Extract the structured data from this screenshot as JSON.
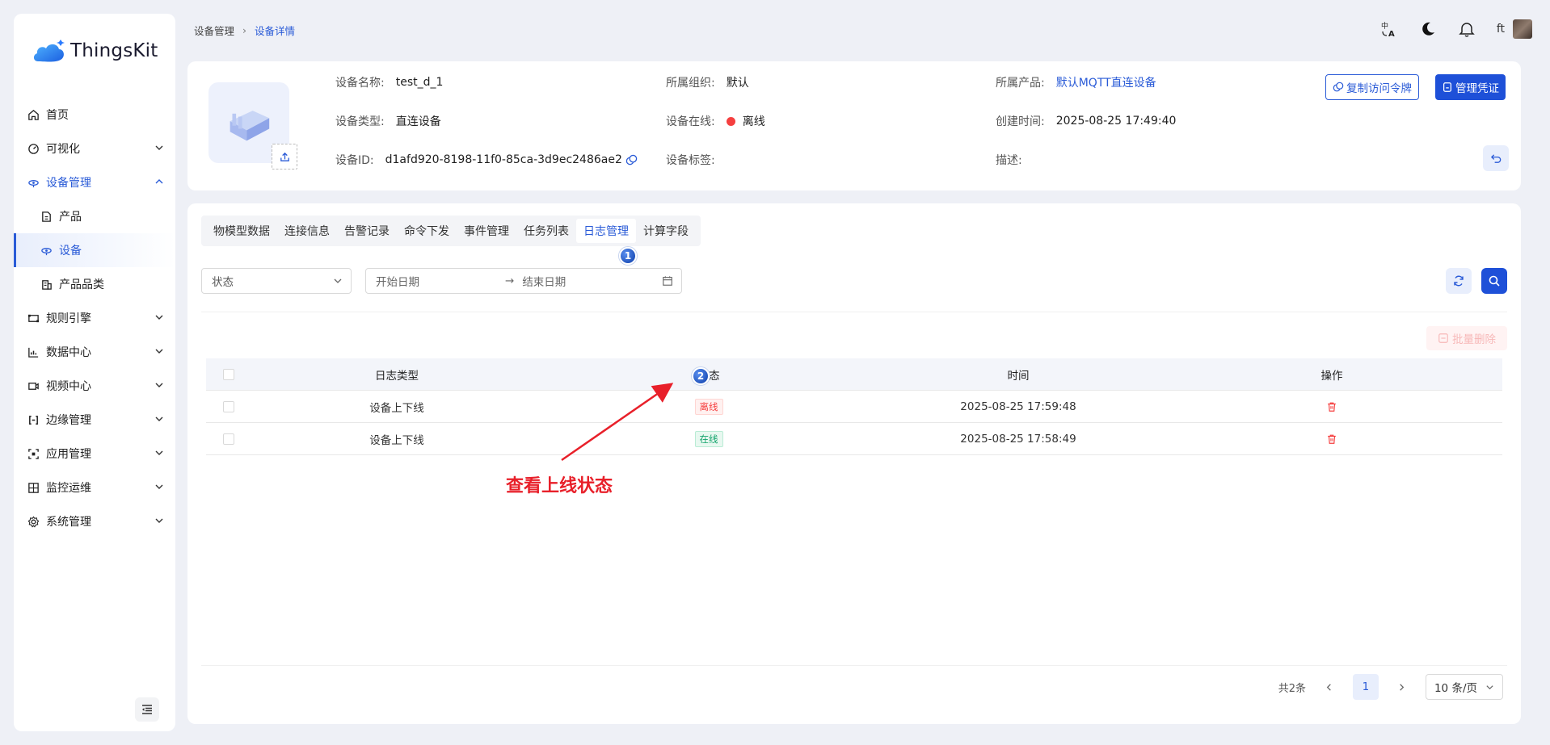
{
  "app": {
    "name": "ThingsKit"
  },
  "sidebar": {
    "items": [
      {
        "label": "首页",
        "icon": "home-icon"
      },
      {
        "label": "可视化",
        "icon": "dashboard-icon"
      },
      {
        "label": "设备管理",
        "icon": "device-icon"
      },
      {
        "label": "产品",
        "icon": "file-icon"
      },
      {
        "label": "设备",
        "icon": "device-icon"
      },
      {
        "label": "产品品类",
        "icon": "building-icon"
      },
      {
        "label": "规则引擎",
        "icon": "rule-icon"
      },
      {
        "label": "数据中心",
        "icon": "chart-icon"
      },
      {
        "label": "视频中心",
        "icon": "video-icon"
      },
      {
        "label": "边缘管理",
        "icon": "edge-icon"
      },
      {
        "label": "应用管理",
        "icon": "app-icon"
      },
      {
        "label": "监控运维",
        "icon": "monitor-icon"
      },
      {
        "label": "系统管理",
        "icon": "gear-icon"
      }
    ]
  },
  "breadcrumb": {
    "parent": "设备管理",
    "current": "设备详情"
  },
  "header": {
    "user": "ft"
  },
  "device": {
    "name_label": "设备名称:",
    "name": "test_d_1",
    "org_label": "所属组织:",
    "org": "默认",
    "product_label": "所属产品:",
    "product": "默认MQTT直连设备",
    "type_label": "设备类型:",
    "type": "直连设备",
    "online_label": "设备在线:",
    "online": "离线",
    "created_label": "创建时间:",
    "created": "2025-08-25 17:49:40",
    "id_label": "设备ID:",
    "id": "d1afd920-8198-11f0-85ca-3d9ec2486ae2",
    "tags_label": "设备标签:",
    "desc_label": "描述:",
    "copy_token_label": "复制访问令牌",
    "credential_label": "管理凭证"
  },
  "tabs": [
    "物模型数据",
    "连接信息",
    "告警记录",
    "命令下发",
    "事件管理",
    "任务列表",
    "日志管理",
    "计算字段"
  ],
  "filters": {
    "status_placeholder": "状态",
    "start_placeholder": "开始日期",
    "end_placeholder": "结束日期"
  },
  "batch_delete_label": "批量删除",
  "table": {
    "headers": [
      "日志类型",
      "状态",
      "时间",
      "操作"
    ],
    "rows": [
      {
        "type": "设备上下线",
        "status": "离线",
        "time": "2025-08-25 17:59:48"
      },
      {
        "type": "设备上下线",
        "status": "在线",
        "time": "2025-08-25 17:58:49"
      }
    ]
  },
  "pagination": {
    "total": "共2条",
    "page": "1",
    "size": "10 条/页"
  },
  "annotations": {
    "step1": "1",
    "step2": "2",
    "note": "查看上线状态"
  },
  "colors": {
    "primary": "#2a5bd7",
    "offline": "#f53f3f",
    "online": "#12a36b",
    "annotation": "#e8202a"
  }
}
